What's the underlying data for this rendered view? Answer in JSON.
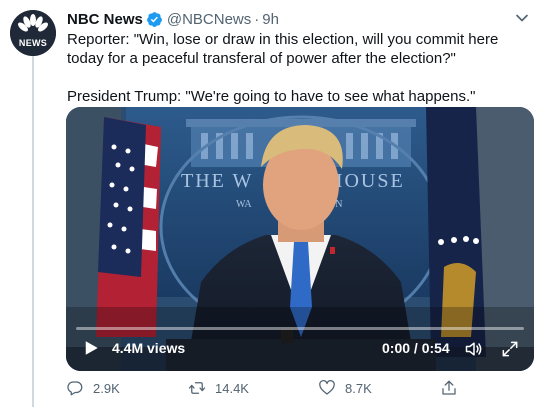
{
  "tweet": {
    "display_name": "NBC News",
    "handle": "@NBCNews",
    "separator": "·",
    "time": "9h",
    "text_line_1": "Reporter: \"Win, lose or draw in this election, will you commit here today for a peaceful transferal of power after the election?\"",
    "text_line_2": "President Trump: \"We're going to have to see what happens.\"",
    "avatar_text": "NEWS"
  },
  "video": {
    "views": "4.4M views",
    "timecode": "0:00 / 0:54",
    "backdrop_text_left": "THE W",
    "backdrop_text_right": "HOUSE",
    "backdrop_text_small_left": "WA",
    "backdrop_text_small_right": "ON",
    "progress": 0
  },
  "actions": {
    "replies": "2.9K",
    "retweets": "14.4K",
    "likes": "8.7K"
  },
  "colors": {
    "text": "#0f1419",
    "muted": "#536471",
    "verified": "#1d9bf0",
    "podium_blue": "#1b3a5e"
  },
  "icons": [
    "nbc-peacock-icon",
    "verified-badge-icon",
    "chevron-down-icon",
    "play-icon",
    "volume-icon",
    "fullscreen-icon",
    "reply-icon",
    "retweet-icon",
    "like-icon",
    "share-icon"
  ]
}
